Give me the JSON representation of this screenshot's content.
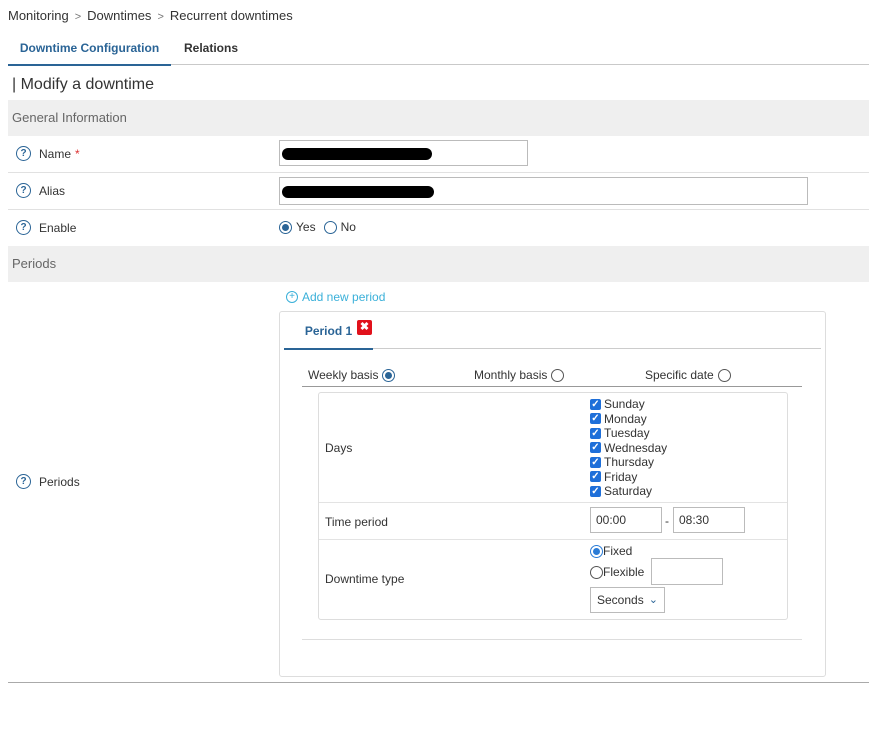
{
  "breadcrumb": [
    "Monitoring",
    "Downtimes",
    "Recurrent downtimes"
  ],
  "breadcrumb_sep": ">",
  "tabs": [
    {
      "label": "Downtime Configuration",
      "active": true
    },
    {
      "label": "Relations",
      "active": false
    }
  ],
  "page_title": "| Modify a downtime",
  "general_section": "General Information",
  "fields": {
    "name": {
      "label": "Name",
      "required": "*",
      "value": ""
    },
    "alias": {
      "label": "Alias",
      "value": ""
    },
    "enable": {
      "label": "Enable",
      "yes": "Yes",
      "no": "No",
      "selected": "Yes"
    }
  },
  "periods_section": "Periods",
  "periods": {
    "label": "Periods",
    "add_label": "Add new period",
    "tab_label": "Period 1",
    "delete_glyph": "✖",
    "basis": {
      "weekly": "Weekly basis",
      "monthly": "Monthly basis",
      "specific": "Specific date",
      "selected": "weekly"
    },
    "days_label": "Days",
    "days": [
      "Sunday",
      "Monday",
      "Tuesday",
      "Wednesday",
      "Thursday",
      "Friday",
      "Saturday"
    ],
    "time_label": "Time period",
    "time_start": "00:00",
    "time_sep": "-",
    "time_end": "08:30",
    "type_label": "Downtime type",
    "type_fixed": "Fixed",
    "type_flexible": "Flexible",
    "type_selected": "Fixed",
    "duration_value": "",
    "unit_selected": "Seconds"
  },
  "colors": {
    "accent": "#2a6496",
    "link": "#3ab0d9",
    "danger": "#e1111b",
    "checkbox": "#1e6fd9"
  },
  "icons": {
    "help": "help-circle-icon",
    "add": "plus-circle-icon",
    "delete": "close-icon",
    "dropdown": "chevron-down-icon"
  }
}
